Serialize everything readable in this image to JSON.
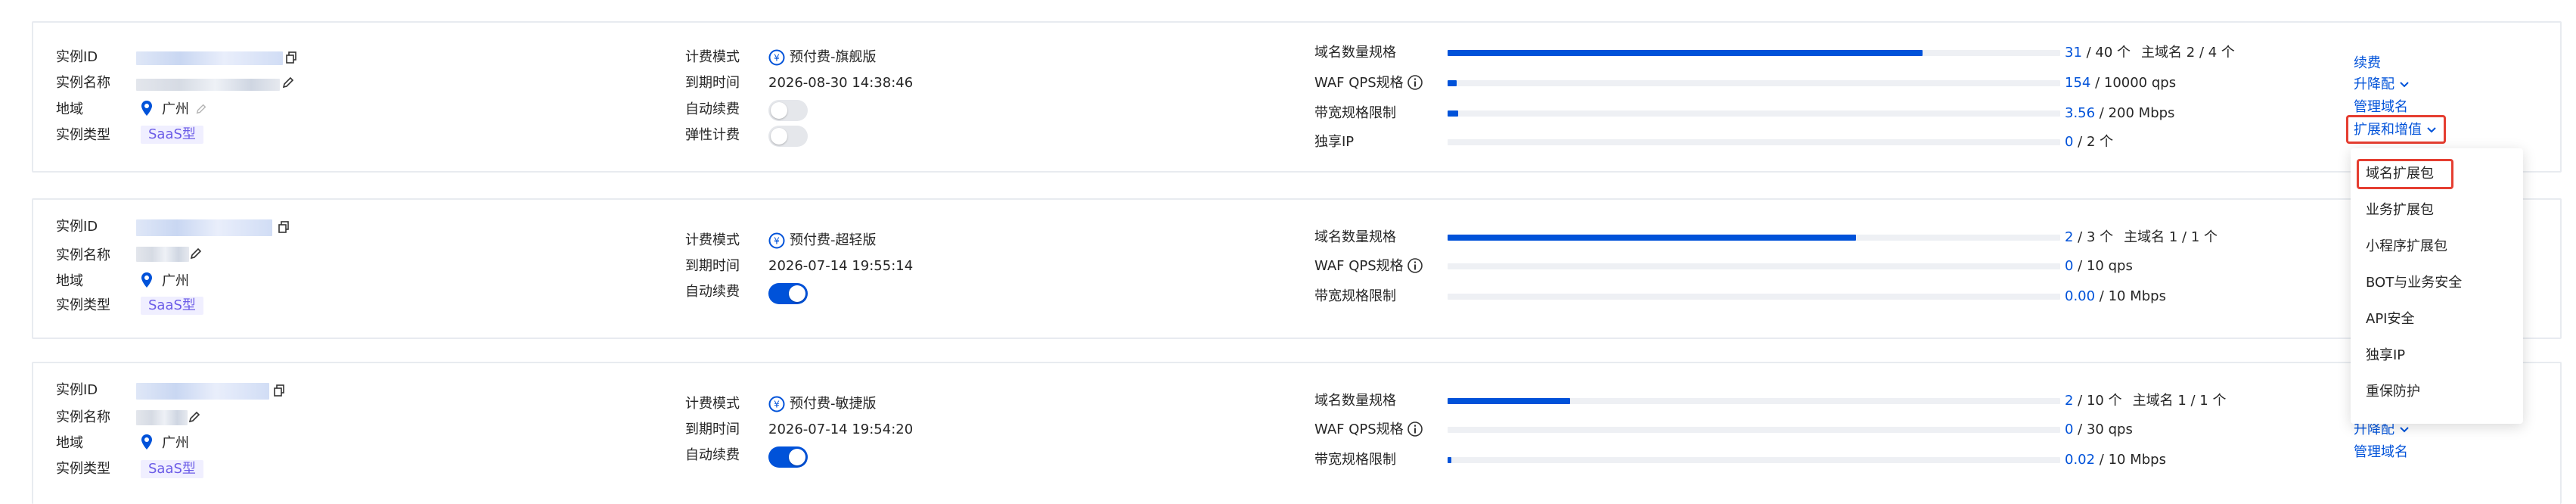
{
  "labels": {
    "instance_id": "实例ID",
    "instance_name": "实例名称",
    "region": "地域",
    "instance_type": "实例类型",
    "billing_mode": "计费模式",
    "expire_time": "到期时间",
    "auto_renew": "自动续费",
    "elastic_billing": "弹性计费",
    "domain_quota": "域名数量规格",
    "waf_qps": "WAF QPS规格",
    "bandwidth": "带宽规格限制",
    "dedicated_ip": "独享IP"
  },
  "colors": {
    "accent": "#0052d9",
    "tag_bg": "#f0efff",
    "tag_text": "#6b5ce7",
    "highlight": "#e53e31"
  },
  "instances": [
    {
      "region": "广州",
      "type_tag": "SaaS型",
      "billing_mode": "预付费-旗舰版",
      "expire_time": "2026-08-30 14:38:46",
      "auto_renew": false,
      "elastic_billing": false,
      "domain_used": "31",
      "domain_total": " / 40 个",
      "main_domain": "主域名 2 / 4 个",
      "domain_ratio": 0.775,
      "qps_used": "154",
      "qps_total": " / 10000 qps",
      "qps_ratio": 0.0154,
      "bw_used": "3.56",
      "bw_total": " / 200 Mbps",
      "bw_ratio": 0.0178,
      "ip_used": "0",
      "ip_total": " / 2 个",
      "ip_ratio": 0,
      "actions": {
        "renew": "续费",
        "upgrade": "升降配",
        "manage_domain": "管理域名",
        "expand": "扩展和增值"
      }
    },
    {
      "region": "广州",
      "type_tag": "SaaS型",
      "billing_mode": "预付费-超轻版",
      "expire_time": "2026-07-14 19:55:14",
      "auto_renew": true,
      "domain_used": "2",
      "domain_total": " / 3 个",
      "main_domain": "主域名 1 / 1 个",
      "domain_ratio": 0.667,
      "qps_used": "0",
      "qps_total": " / 10 qps",
      "qps_ratio": 0,
      "bw_used": "0.00",
      "bw_total": " / 10 Mbps",
      "bw_ratio": 0
    },
    {
      "region": "广州",
      "type_tag": "SaaS型",
      "billing_mode": "预付费-敏捷版",
      "expire_time": "2026-07-14 19:54:20",
      "auto_renew": true,
      "domain_used": "2",
      "domain_total": " / 10 个",
      "main_domain": "主域名 1 / 1 个",
      "domain_ratio": 0.2,
      "qps_used": "0",
      "qps_total": " / 30 qps",
      "qps_ratio": 0,
      "bw_used": "0.02",
      "bw_total": " / 10 Mbps",
      "bw_ratio": 0.002,
      "actions": {
        "upgrade": "升降配",
        "manage_domain": "管理域名"
      }
    }
  ],
  "expand_menu": {
    "items": [
      "域名扩展包",
      "业务扩展包",
      "小程序扩展包",
      "BOT与业务安全",
      "API安全",
      "独享IP",
      "重保防护"
    ],
    "highlighted_index": 0
  }
}
